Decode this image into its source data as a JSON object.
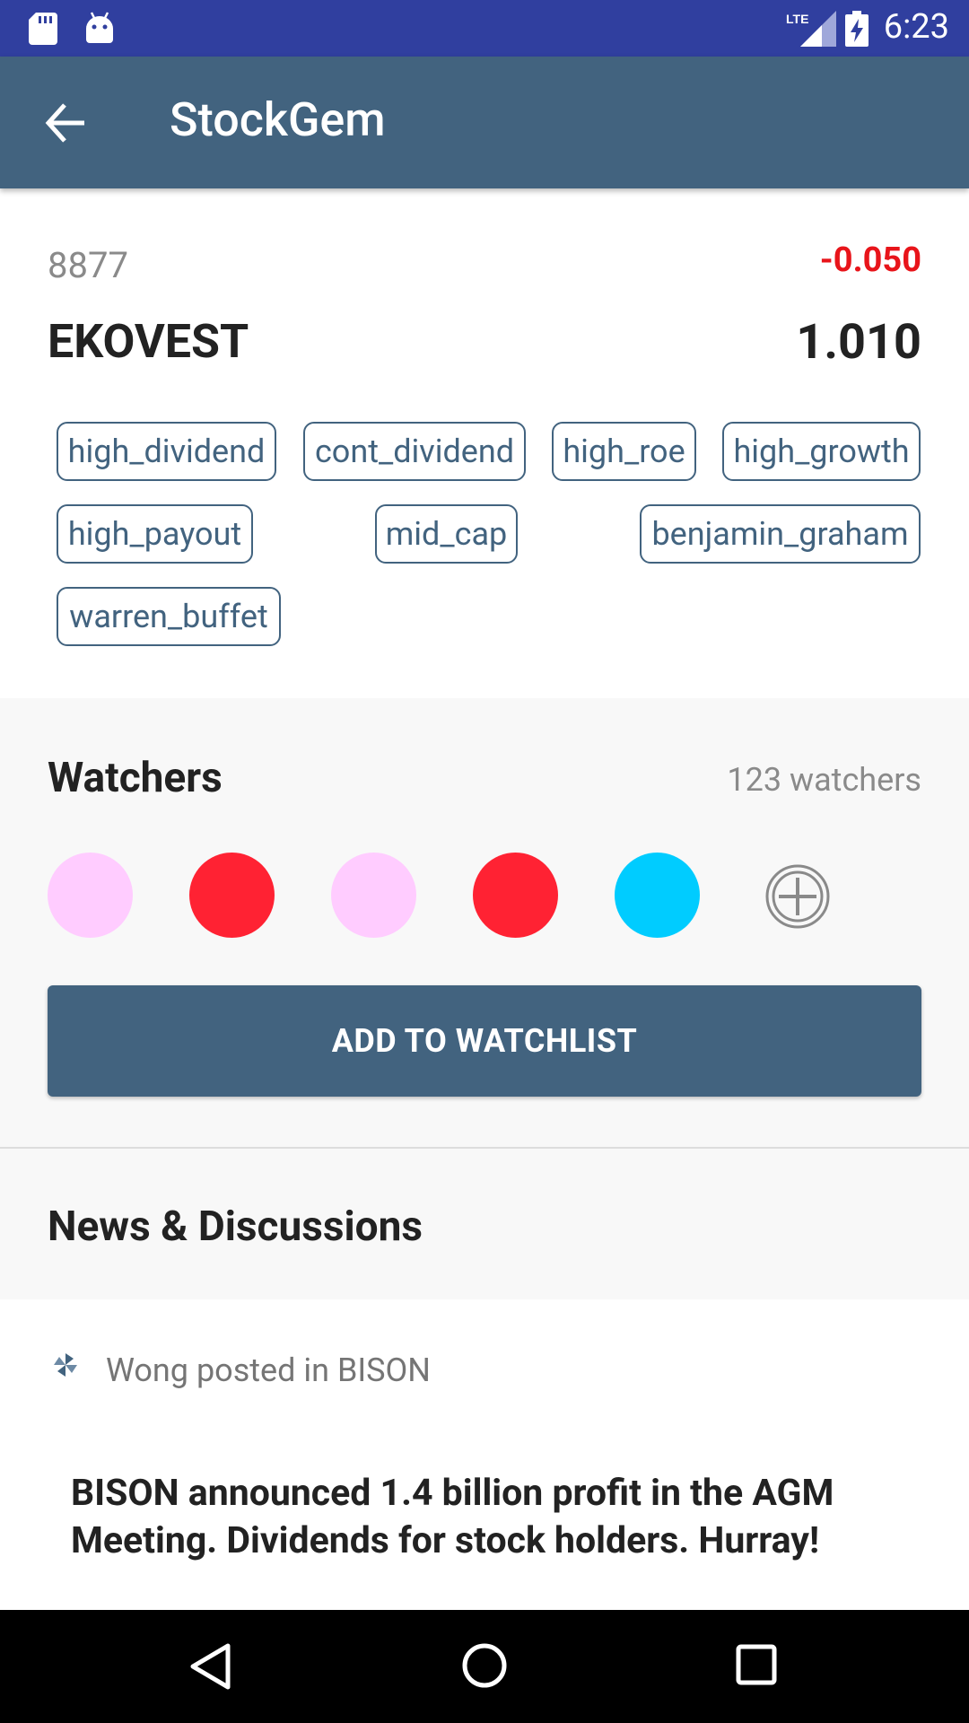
{
  "status_bar": {
    "lte_label": "LTE",
    "time": "6:23"
  },
  "app_bar": {
    "title": "StockGem"
  },
  "stock": {
    "code": "8877",
    "change": "-0.050",
    "name": "EKOVEST",
    "price": "1.010",
    "change_color": "#e8141a",
    "tags": [
      "high_dividend",
      "cont_dividend",
      "high_roe",
      "high_growth",
      "high_payout",
      "mid_cap",
      "benjamin_graham",
      "warren_buffet"
    ]
  },
  "watchers": {
    "title": "Watchers",
    "count_label": "123 watchers",
    "avatar_colors": [
      "#ffccff",
      "#ff2233",
      "#ffccff",
      "#ff2233",
      "#00ccff"
    ],
    "add_button_label": "ADD TO WATCHLIST"
  },
  "news": {
    "title": "News & Discussions",
    "posts": [
      {
        "meta": "Wong posted in BISON",
        "body": "BISON announced 1.4 billion profit  in the AGM Meeting. Dividends for stock holders. Hurray!"
      }
    ]
  },
  "theme": {
    "primary": "#42637f",
    "status_bar": "#303f9f"
  }
}
